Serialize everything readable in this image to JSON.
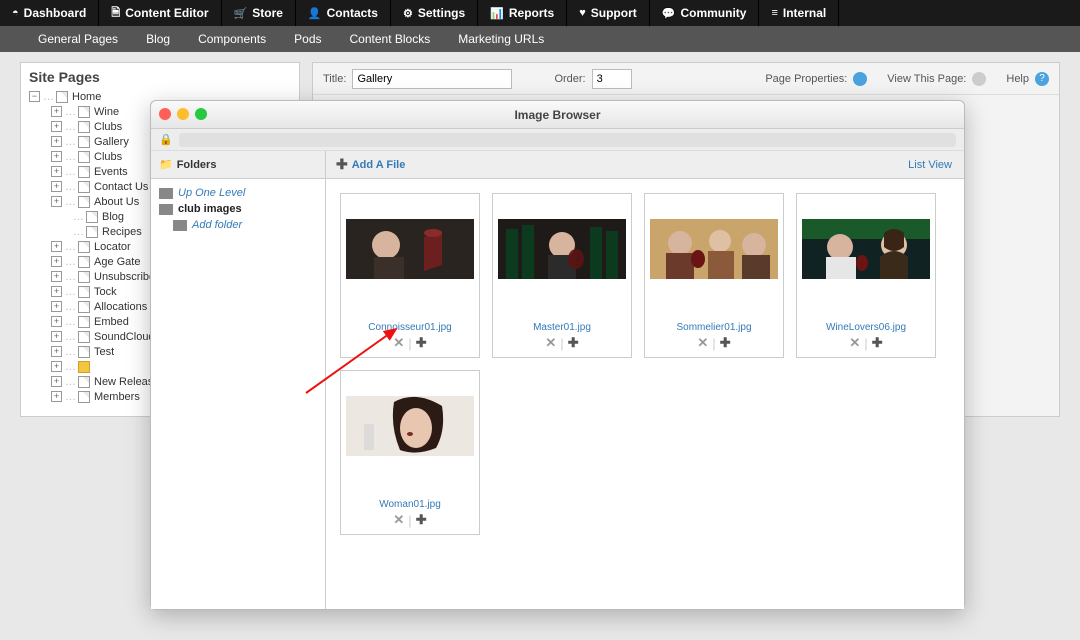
{
  "topnav": [
    {
      "label": "Dashboard",
      "icon": "◓"
    },
    {
      "label": "Content Editor",
      "icon": "🗎"
    },
    {
      "label": "Store",
      "icon": "🛒"
    },
    {
      "label": "Contacts",
      "icon": "👤"
    },
    {
      "label": "Settings",
      "icon": "⚙"
    },
    {
      "label": "Reports",
      "icon": "📊"
    },
    {
      "label": "Support",
      "icon": "♥"
    },
    {
      "label": "Community",
      "icon": "💬"
    },
    {
      "label": "Internal",
      "icon": "≡"
    }
  ],
  "subnav": [
    "General Pages",
    "Blog",
    "Components",
    "Pods",
    "Content Blocks",
    "Marketing URLs"
  ],
  "treepanel": {
    "title": "Site Pages",
    "root": "Home",
    "children": [
      "Wine",
      "Clubs",
      "Gallery",
      "Clubs",
      "Events",
      "Contact Us",
      "About Us"
    ],
    "aboutChildren": [
      "Blog",
      "Recipes"
    ],
    "rest": [
      "Locator",
      "Age Gate",
      "Unsubscribe M",
      "Tock",
      "Allocations",
      "Embed",
      "SoundCloud Te",
      "Test"
    ],
    "locked": "",
    "tail": [
      "New Releases",
      "Members"
    ]
  },
  "contentbar": {
    "titleLabel": "Title:",
    "titleValue": "Gallery",
    "orderLabel": "Order:",
    "orderValue": "3",
    "pageProps": "Page Properties:",
    "viewPage": "View This Page:",
    "help": "Help"
  },
  "modal": {
    "title": "Image Browser",
    "foldersLabel": "Folders",
    "addFile": "Add A File",
    "listView": "List View",
    "sidebar": {
      "upOne": "Up One Level",
      "current": "club images",
      "addFolder": "Add folder"
    },
    "files": [
      "Connoisseur01.jpg",
      "Master01.jpg",
      "Sommelier01.jpg",
      "WineLovers06.jpg",
      "Woman01.jpg"
    ]
  }
}
